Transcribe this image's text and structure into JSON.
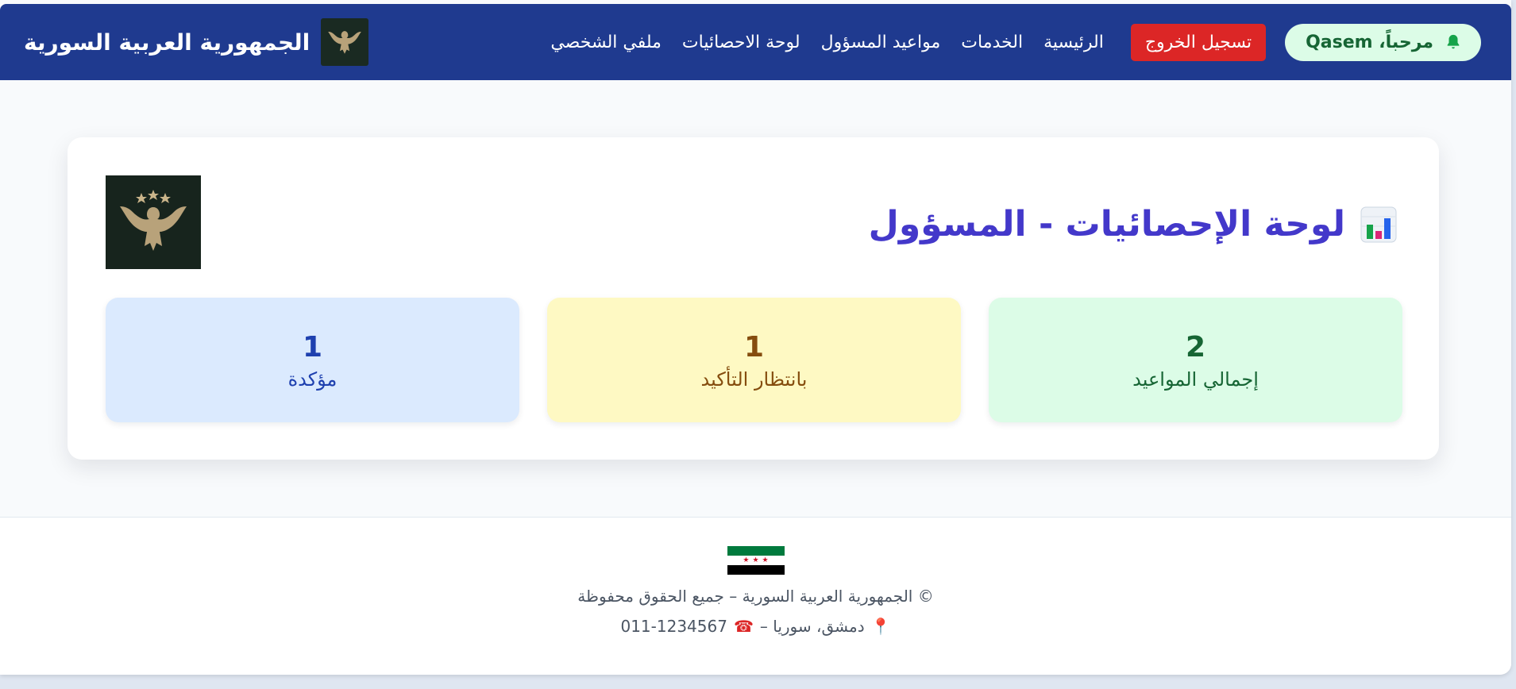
{
  "navbar": {
    "welcome": "مرحباً، Qasem",
    "logout": "تسجيل الخروج",
    "links": [
      "الرئيسية",
      "الخدمات",
      "مواعيد المسؤول",
      "لوحة الاحصائيات",
      "ملفي الشخصي"
    ],
    "brand": "الجمهورية العربية السورية",
    "bg_color": "#1f3a8f"
  },
  "card": {
    "title": "لوحة الإحصائيات - المسؤول",
    "stats": {
      "total": {
        "value": "2",
        "label": "إجمالي المواعيد",
        "color": "#dcfce7"
      },
      "pending": {
        "value": "1",
        "label": "بانتظار التأكيد",
        "color": "#fef9c3"
      },
      "confirmed": {
        "value": "1",
        "label": "مؤكدة",
        "color": "#dbeafe"
      }
    }
  },
  "footer": {
    "copyright": "© الجمهورية العربية السورية – جميع الحقوق محفوظة",
    "address": "دمشق، سوريا –",
    "phone": "011-1234567"
  },
  "icons": {
    "bell": "bell-icon",
    "chart": "bar-chart-icon",
    "pin": "pin-icon",
    "telephone": "telephone-icon",
    "eagle": "eagle-emblem-icon",
    "flag": "syrian-flag-icon"
  }
}
